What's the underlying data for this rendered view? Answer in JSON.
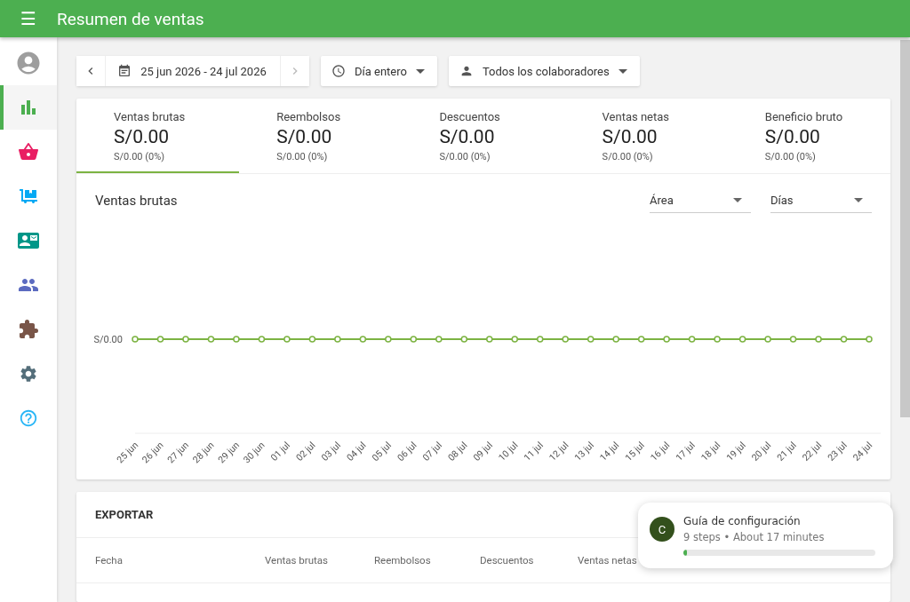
{
  "header": {
    "menu": "☰",
    "title": "Resumen de ventas"
  },
  "sidebar": {
    "items": [
      {
        "kind": "account",
        "selected": false,
        "color": "#9e9e9e"
      },
      {
        "kind": "reports",
        "selected": true,
        "color": "#4caf50"
      },
      {
        "kind": "items",
        "selected": false,
        "color": "#e91e63"
      },
      {
        "kind": "inventory",
        "selected": false,
        "color": "#03a9f4"
      },
      {
        "kind": "customers",
        "selected": false,
        "color": "#009688"
      },
      {
        "kind": "employees",
        "selected": false,
        "color": "#5c6bc0"
      },
      {
        "kind": "integrations",
        "selected": false,
        "color": "#795548"
      },
      {
        "kind": "settings",
        "selected": false,
        "color": "#546e7a"
      },
      {
        "kind": "help",
        "selected": false,
        "color": "#29b6f6"
      }
    ]
  },
  "toolbar": {
    "date_range": "25 jun 2026 - 24 jul 2026",
    "time": "Día entero",
    "employees": "Todos los colaboradores"
  },
  "summary": [
    {
      "label": "Ventas brutas",
      "value": "S/0.00",
      "change": "S/0.00 (0%)",
      "selected": true
    },
    {
      "label": "Reembolsos",
      "value": "S/0.00",
      "change": "S/0.00 (0%)",
      "selected": false
    },
    {
      "label": "Descuentos",
      "value": "S/0.00",
      "change": "S/0.00 (0%)",
      "selected": false
    },
    {
      "label": "Ventas netas",
      "value": "S/0.00",
      "change": "S/0.00 (0%)",
      "selected": false
    },
    {
      "label": "Beneficio bruto",
      "value": "S/0.00",
      "change": "S/0.00 (0%)",
      "selected": false
    }
  ],
  "chart": {
    "title": "Ventas brutas",
    "chart_type_select": "Área",
    "period_select": "Días",
    "x_labels": [
      "25 jun",
      "26 jun",
      "27 jun",
      "28 jun",
      "29 jun",
      "30 jun",
      "01 jul",
      "02 jul",
      "03 jul",
      "04 jul",
      "05 jul",
      "06 jul",
      "07 jul",
      "08 jul",
      "09 jul",
      "10 jul",
      "11 jul",
      "12 jul",
      "13 jul",
      "14 jul",
      "15 jul",
      "16 jul",
      "17 jul",
      "18 jul",
      "19 jul",
      "20 jul",
      "21 jul",
      "22 jul",
      "23 jul",
      "24 jul"
    ],
    "y_label": "S/0.00"
  },
  "export": {
    "title": "EXPORTAR",
    "columns": [
      "Fecha",
      "Ventas brutas",
      "Reembolsos",
      "Descuentos",
      "Ventas netas"
    ]
  },
  "guide": {
    "avatar": "C",
    "title": "Guía de configuración",
    "subtitle": "9 steps • About 17 minutes",
    "level": 0.02
  }
}
